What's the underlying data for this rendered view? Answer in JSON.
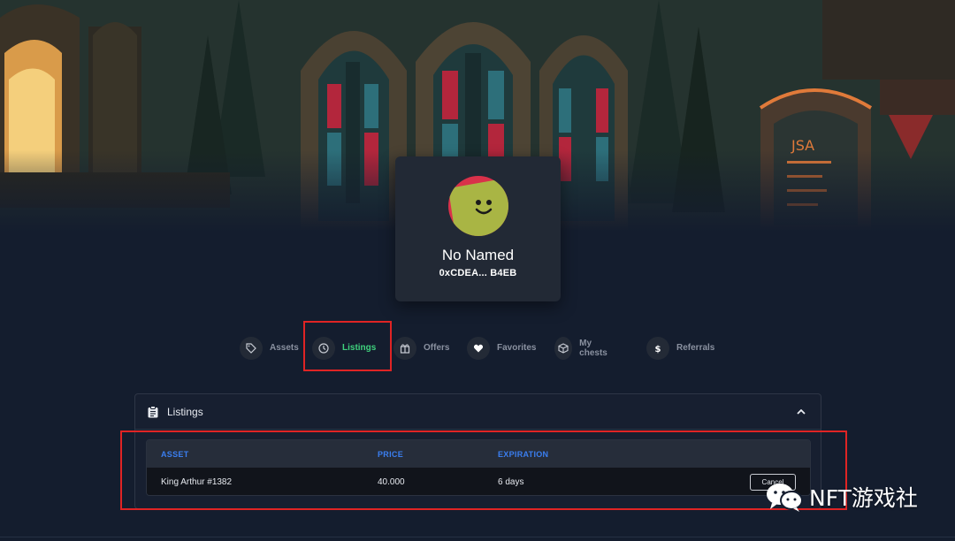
{
  "profile": {
    "name": "No Named",
    "address": "0xCDEA... B4EB"
  },
  "tabs": [
    {
      "label": "Assets",
      "icon": "tag-icon",
      "active": false
    },
    {
      "label": "Listings",
      "icon": "clock-icon",
      "active": true
    },
    {
      "label": "Offers",
      "icon": "gift-icon",
      "active": false
    },
    {
      "label": "Favorites",
      "icon": "heart-icon",
      "active": false
    },
    {
      "label": "My chests",
      "icon": "box-icon",
      "active": false
    },
    {
      "label": "Referrals",
      "icon": "dollar-icon",
      "active": false
    }
  ],
  "listings": {
    "title": "Listings",
    "columns": [
      "ASSET",
      "PRICE",
      "EXPIRATION"
    ],
    "rows": [
      {
        "asset": "King Arthur #1382",
        "price": "40.000",
        "expiration": "6 days",
        "action": "Cancel"
      }
    ]
  },
  "watermark": {
    "text": "NFT游戏社"
  },
  "colors": {
    "background": "#141d2e",
    "accent_green": "#3fd17d",
    "header_blue": "#3a7ef0",
    "highlight_red": "#e02424"
  }
}
